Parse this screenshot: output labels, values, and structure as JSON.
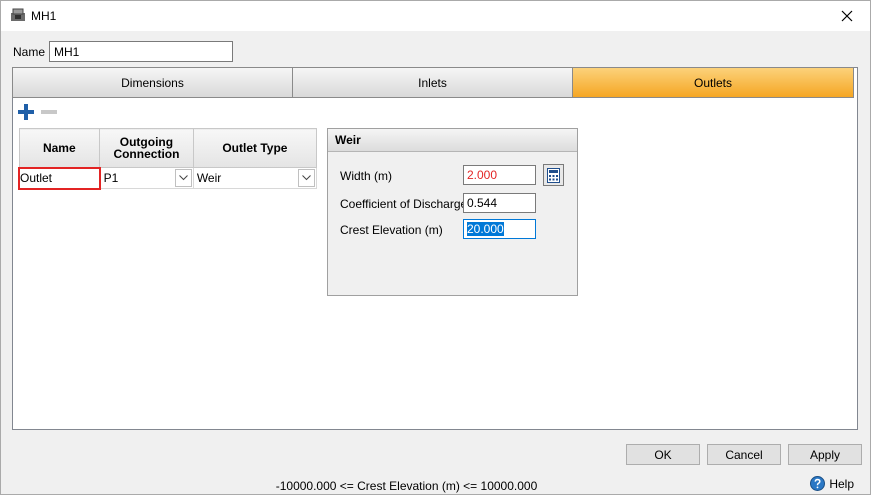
{
  "window": {
    "title": "MH1",
    "close_icon": "close-icon",
    "app_icon": "manhole-icon"
  },
  "name_field": {
    "label": "Name",
    "value": "MH1"
  },
  "tabs": [
    {
      "label": "Dimensions",
      "active": false
    },
    {
      "label": "Inlets",
      "active": false
    },
    {
      "label": "Outlets",
      "active": true
    }
  ],
  "toolbar": {
    "add_icon": "plus-icon",
    "remove_icon": "minus-icon"
  },
  "outlets_grid": {
    "headers": {
      "name": "Name",
      "connection": "Outgoing Connection",
      "type": "Outlet Type"
    },
    "rows": [
      {
        "name": "Outlet",
        "connection": "P1",
        "type": "Weir"
      }
    ]
  },
  "weir": {
    "title": "Weir",
    "width_label": "Width (m)",
    "width_value": "2.000",
    "discharge_label": "Coefficient of Discharge",
    "discharge_value": "0.544",
    "crest_label": "Crest Elevation (m)",
    "crest_value": "20.000",
    "calculator_icon": "calculator-icon"
  },
  "buttons": {
    "ok": "OK",
    "cancel": "Cancel",
    "apply": "Apply"
  },
  "status": {
    "message": "-10000.000 <= Crest Elevation (m) <= 10000.000",
    "help_label": "Help",
    "help_icon": "help-icon"
  },
  "colors": {
    "active_tab": "#f5a623",
    "error_text": "#e32424",
    "selection": "#0078d7",
    "accent_blue": "#1f5fa8"
  }
}
